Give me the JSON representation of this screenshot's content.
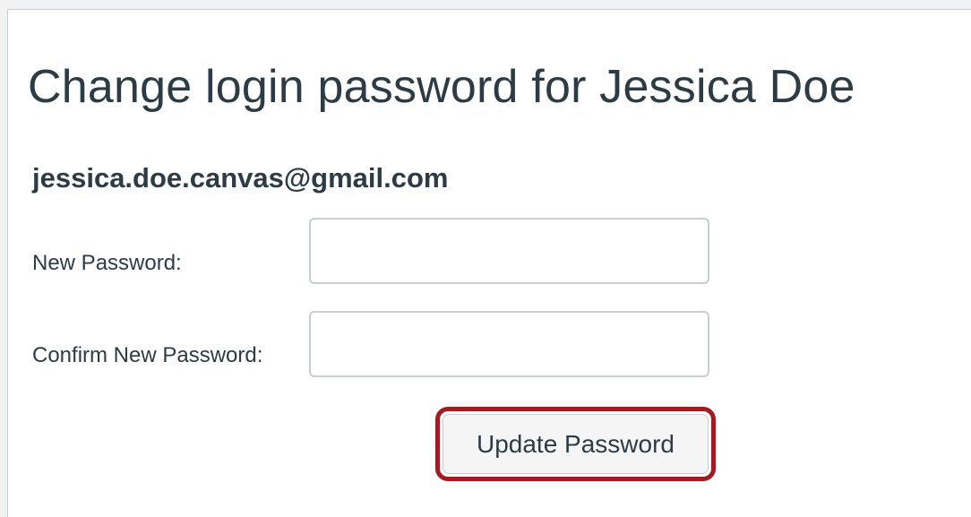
{
  "dialog": {
    "title": "Change login password for Jessica Doe",
    "email": "jessica.doe.canvas@gmail.com"
  },
  "form": {
    "new_password_label": "New Password:",
    "new_password_value": "",
    "confirm_password_label": "Confirm New Password:",
    "confirm_password_value": ""
  },
  "actions": {
    "update_label": "Update Password",
    "highlight_color": "#a01c22"
  }
}
